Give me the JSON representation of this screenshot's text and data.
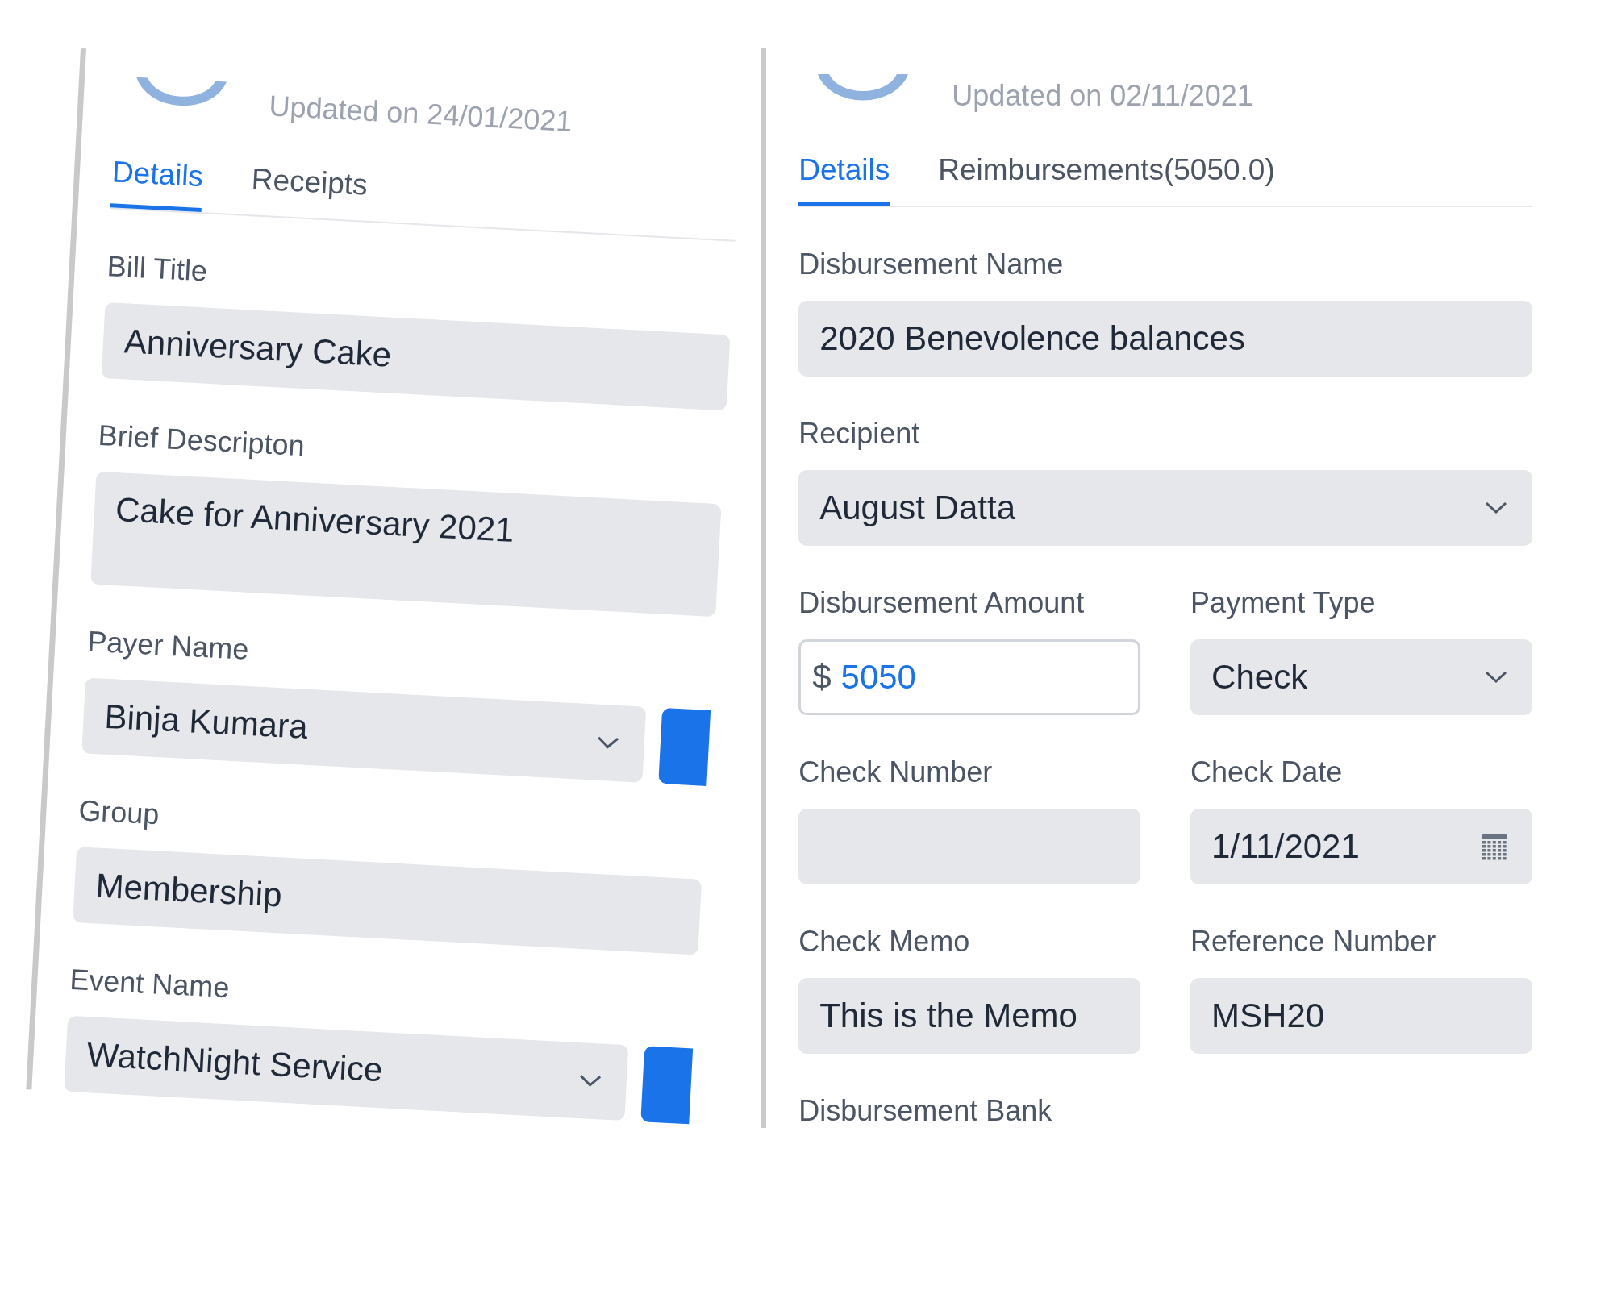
{
  "panels": [
    {
      "updated": "Updated on 24/01/2021",
      "tilted": true,
      "tabs": [
        {
          "label": "Details",
          "selected": true
        },
        {
          "label": "Receipts",
          "selected": false
        }
      ],
      "rows": [
        [
          {
            "label": "Bill Title",
            "kind": "text",
            "value": "Anniversary Cake"
          }
        ],
        [
          {
            "label": "Brief Descripton",
            "kind": "textarea",
            "value": "Cake for Anniversary 2021"
          }
        ],
        [
          {
            "label": "Payer Name",
            "kind": "select",
            "value": "Binja Kumara",
            "side_button": true
          }
        ],
        [
          {
            "label": "Group",
            "kind": "text",
            "value": "Membership"
          }
        ],
        [
          {
            "label": "Event Name",
            "kind": "select",
            "value": "WatchNight Service",
            "side_button": true
          }
        ]
      ]
    },
    {
      "updated": "Updated on 02/11/2021",
      "tilted": false,
      "tabs": [
        {
          "label": "Details",
          "selected": true
        },
        {
          "label": "Reimbursements(5050.0)",
          "selected": false
        }
      ],
      "rows": [
        [
          {
            "label": "Disbursement Name",
            "kind": "text",
            "value": "2020 Benevolence balances"
          }
        ],
        [
          {
            "label": "Recipient",
            "kind": "select",
            "value": "August Datta"
          }
        ],
        [
          {
            "label": "Disbursement Amount",
            "kind": "amount",
            "prefix": "$",
            "value": "5050"
          },
          {
            "label": "Payment Type",
            "kind": "select",
            "value": "Check"
          }
        ],
        [
          {
            "label": "Check Number",
            "kind": "text"
          },
          {
            "label": "Check Date",
            "kind": "date",
            "value": "1/11/2021"
          }
        ],
        [
          {
            "label": "Check Memo",
            "kind": "text",
            "value": "This is the Memo"
          },
          {
            "label": "Reference Number",
            "kind": "text",
            "value": "MSH20"
          }
        ],
        [
          {
            "label": "Disbursement Bank",
            "kind": "label"
          }
        ]
      ]
    }
  ]
}
